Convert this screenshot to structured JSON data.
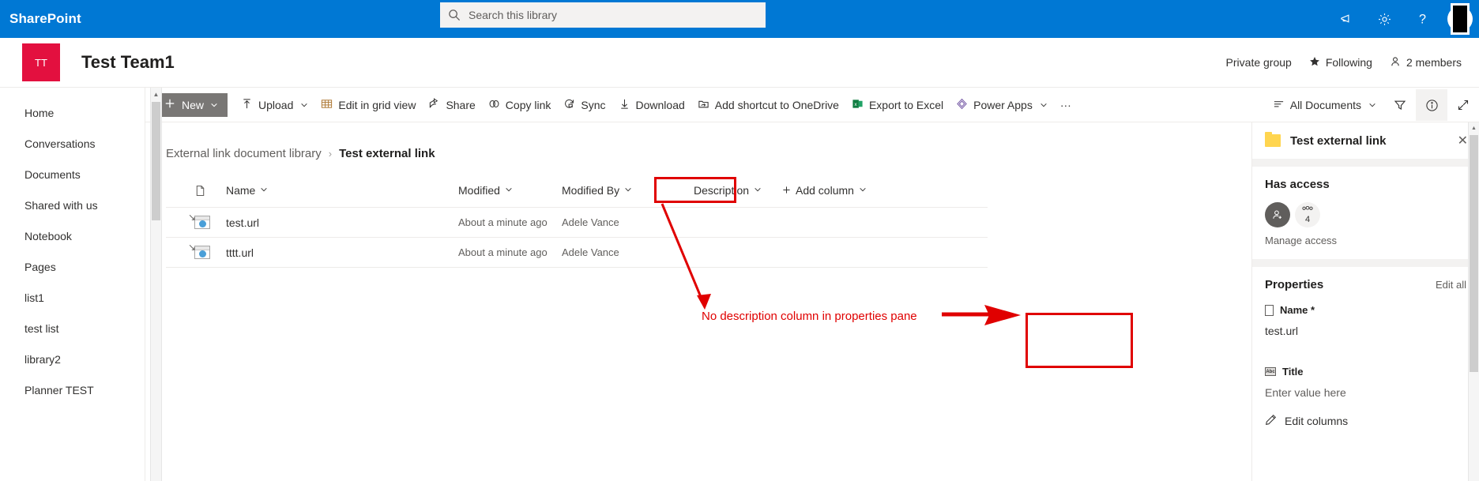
{
  "suitebar": {
    "brand": "SharePoint",
    "search_placeholder": "Search this library",
    "search_value": "",
    "icons": {
      "megaphone": "megaphone-icon",
      "settings": "gear-icon",
      "help": "help-icon",
      "account": "account-avatar"
    }
  },
  "site_header": {
    "logo_initials": "TT",
    "title": "Test Team1",
    "privacy": "Private group",
    "following": "Following",
    "members": "2 members"
  },
  "sidebar": {
    "items": [
      {
        "label": "Home"
      },
      {
        "label": "Conversations"
      },
      {
        "label": "Documents"
      },
      {
        "label": "Shared with us"
      },
      {
        "label": "Notebook"
      },
      {
        "label": "Pages"
      },
      {
        "label": "list1"
      },
      {
        "label": "test list"
      },
      {
        "label": "library2"
      },
      {
        "label": "Planner TEST"
      }
    ]
  },
  "commandbar": {
    "new_label": "New",
    "items": [
      {
        "label": "Upload",
        "icon": "upload-icon",
        "has_chevron": true
      },
      {
        "label": "Edit in grid view",
        "icon": "grid-icon",
        "has_chevron": false
      },
      {
        "label": "Share",
        "icon": "share-icon",
        "has_chevron": false
      },
      {
        "label": "Copy link",
        "icon": "link-icon",
        "has_chevron": false
      },
      {
        "label": "Sync",
        "icon": "sync-icon",
        "has_chevron": false
      },
      {
        "label": "Download",
        "icon": "download-icon",
        "has_chevron": false
      },
      {
        "label": "Add shortcut to OneDrive",
        "icon": "onedrive-shortcut-icon",
        "has_chevron": false
      },
      {
        "label": "Export to Excel",
        "icon": "excel-icon",
        "has_chevron": false
      },
      {
        "label": "Power Apps",
        "icon": "powerapps-icon",
        "has_chevron": true
      }
    ],
    "overflow_label": "···",
    "view_label": "All Documents",
    "filter_icon": "filter-icon",
    "info_icon": "info-icon",
    "expand_icon": "expand-icon"
  },
  "breadcrumb": {
    "root": "External link document library",
    "separator": "›",
    "current": "Test external link"
  },
  "file_list": {
    "columns": [
      {
        "label": "Name",
        "key": "name"
      },
      {
        "label": "Modified",
        "key": "modified"
      },
      {
        "label": "Modified By",
        "key": "modified_by"
      },
      {
        "label": "Description",
        "key": "description"
      }
    ],
    "add_column_label": "Add column",
    "rows": [
      {
        "name": "test.url",
        "modified": "About a minute ago",
        "modified_by": "Adele Vance",
        "description": ""
      },
      {
        "name": "tttt.url",
        "modified": "About a minute ago",
        "modified_by": "Adele Vance",
        "description": ""
      }
    ]
  },
  "details_pane": {
    "title": "Test external link",
    "close_label": "✕",
    "has_access": {
      "heading": "Has access",
      "count": "4",
      "manage_label": "Manage access"
    },
    "properties": {
      "heading": "Properties",
      "edit_all_label": "Edit all",
      "fields": [
        {
          "label": "Name *",
          "value": "test.url",
          "is_placeholder": false,
          "icon": "file-icon"
        },
        {
          "label": "Title",
          "value": "Enter value here",
          "is_placeholder": true,
          "icon": "text-icon"
        }
      ],
      "edit_columns_label": "Edit columns"
    }
  },
  "annotation": {
    "text": "No description column in properties pane",
    "color": "#e00000"
  }
}
